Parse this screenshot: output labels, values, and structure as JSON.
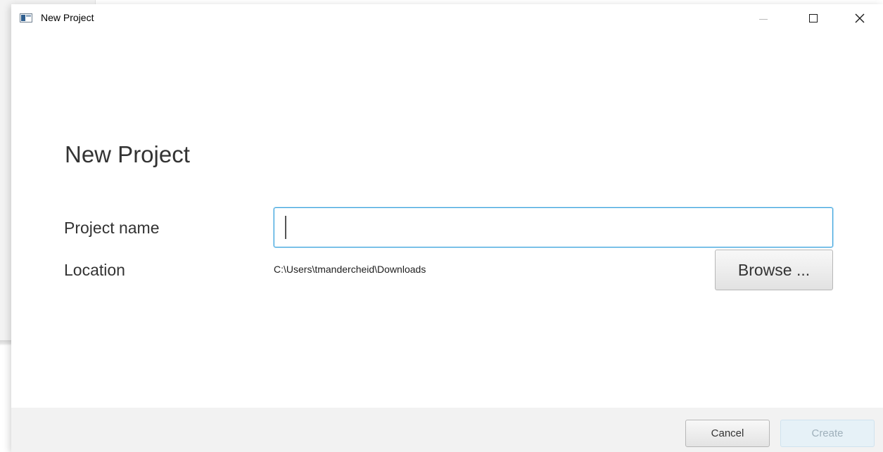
{
  "window": {
    "title": "New Project",
    "icon": "app-window-icon",
    "controls": {
      "minimize_icon": "minimize-icon",
      "maximize_icon": "maximize-icon",
      "close_icon": "close-icon"
    }
  },
  "form": {
    "heading": "New Project",
    "project_name": {
      "label": "Project name",
      "value": "",
      "placeholder": ""
    },
    "location": {
      "label": "Location",
      "path": "C:\\Users\\tmandercheid\\Downloads",
      "browse_label": "Browse ..."
    }
  },
  "footer": {
    "cancel_label": "Cancel",
    "create_label": "Create",
    "create_enabled": false
  },
  "colors": {
    "focus_border": "#3aa3dd",
    "footer_background": "#f2f2f2",
    "disabled_button_background": "#e6f1f7",
    "disabled_button_text": "#9fb0bb"
  }
}
